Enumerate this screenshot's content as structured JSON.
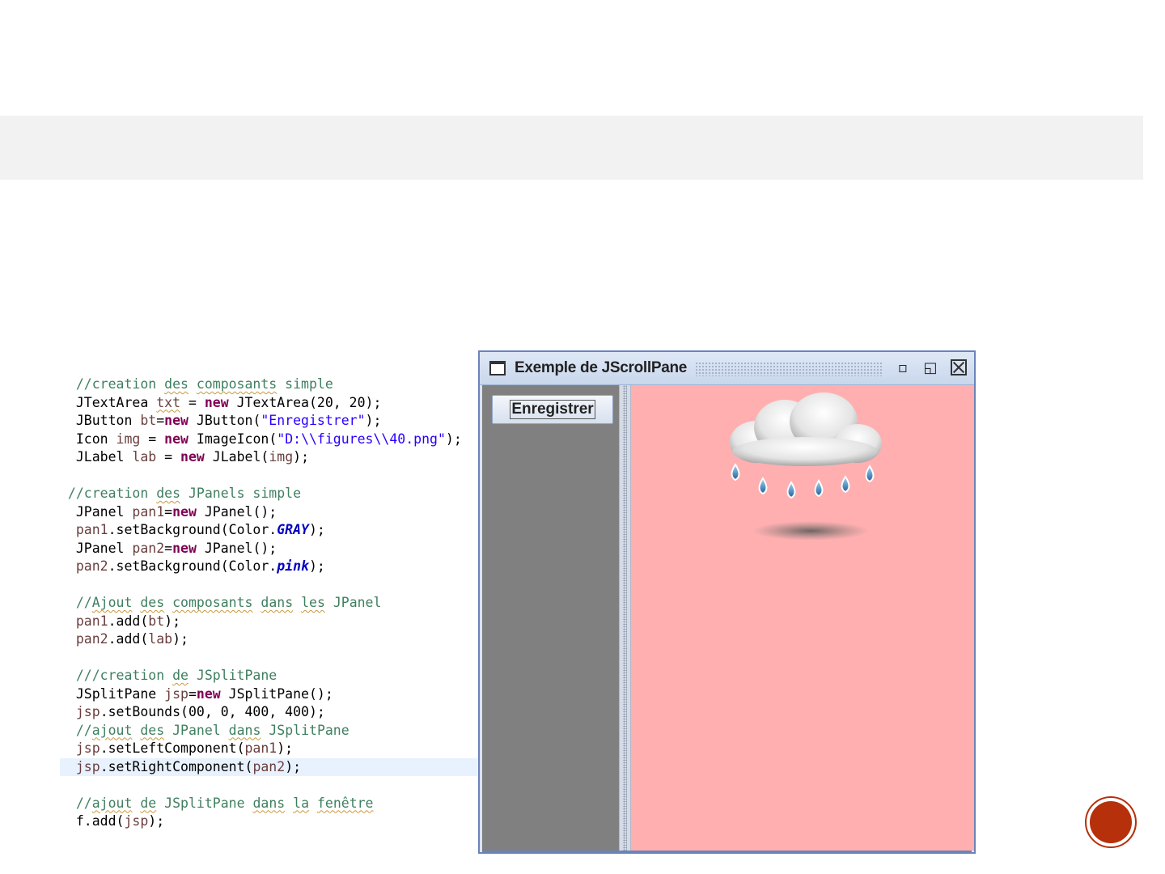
{
  "code_lines": [
    [
      {
        "t": "  //creation ",
        "c": "comment"
      },
      {
        "t": "des",
        "c": "comment",
        "sq": true
      },
      {
        "t": " ",
        "c": "comment"
      },
      {
        "t": "composants",
        "c": "comment",
        "sq": true
      },
      {
        "t": " simple",
        "c": "comment"
      }
    ],
    [
      {
        "t": "  JTextArea ",
        "c": "plain"
      },
      {
        "t": "txt",
        "c": "var",
        "sq": true
      },
      {
        "t": " = ",
        "c": "plain"
      },
      {
        "t": "new",
        "c": "kw"
      },
      {
        "t": " JTextArea(20, 20);",
        "c": "plain"
      }
    ],
    [
      {
        "t": "  JButton ",
        "c": "plain"
      },
      {
        "t": "bt",
        "c": "var"
      },
      {
        "t": "=",
        "c": "plain"
      },
      {
        "t": "new",
        "c": "kw"
      },
      {
        "t": " JButton(",
        "c": "plain"
      },
      {
        "t": "\"Enregistrer\"",
        "c": "str"
      },
      {
        "t": ");",
        "c": "plain"
      }
    ],
    [
      {
        "t": "  Icon ",
        "c": "plain"
      },
      {
        "t": "img",
        "c": "var"
      },
      {
        "t": " = ",
        "c": "plain"
      },
      {
        "t": "new",
        "c": "kw"
      },
      {
        "t": " ImageIcon(",
        "c": "plain"
      },
      {
        "t": "\"D:\\\\figures\\\\40.png\"",
        "c": "str"
      },
      {
        "t": ");",
        "c": "plain"
      }
    ],
    [
      {
        "t": "  JLabel ",
        "c": "plain"
      },
      {
        "t": "lab",
        "c": "var"
      },
      {
        "t": " = ",
        "c": "plain"
      },
      {
        "t": "new",
        "c": "kw"
      },
      {
        "t": " JLabel(",
        "c": "plain"
      },
      {
        "t": "img",
        "c": "var"
      },
      {
        "t": ");",
        "c": "plain"
      }
    ],
    [],
    [
      {
        "t": " //creation ",
        "c": "comment"
      },
      {
        "t": "des",
        "c": "comment",
        "sq": true
      },
      {
        "t": " JPanels simple",
        "c": "comment"
      }
    ],
    [
      {
        "t": "  JPanel ",
        "c": "plain"
      },
      {
        "t": "pan1",
        "c": "var"
      },
      {
        "t": "=",
        "c": "plain"
      },
      {
        "t": "new",
        "c": "kw"
      },
      {
        "t": " JPanel();",
        "c": "plain"
      }
    ],
    [
      {
        "t": "  ",
        "c": "plain"
      },
      {
        "t": "pan1",
        "c": "var"
      },
      {
        "t": ".setBackground(Color.",
        "c": "plain"
      },
      {
        "t": "GRAY",
        "c": "field"
      },
      {
        "t": ");",
        "c": "plain"
      }
    ],
    [
      {
        "t": "  JPanel ",
        "c": "plain"
      },
      {
        "t": "pan2",
        "c": "var"
      },
      {
        "t": "=",
        "c": "plain"
      },
      {
        "t": "new",
        "c": "kw"
      },
      {
        "t": " JPanel();",
        "c": "plain"
      }
    ],
    [
      {
        "t": "  ",
        "c": "plain"
      },
      {
        "t": "pan2",
        "c": "var"
      },
      {
        "t": ".setBackground(Color.",
        "c": "plain"
      },
      {
        "t": "pink",
        "c": "field"
      },
      {
        "t": ");",
        "c": "plain"
      }
    ],
    [],
    [
      {
        "t": "  //",
        "c": "comment"
      },
      {
        "t": "Ajout",
        "c": "comment",
        "sq": true
      },
      {
        "t": " ",
        "c": "comment"
      },
      {
        "t": "des",
        "c": "comment",
        "sq": true
      },
      {
        "t": " ",
        "c": "comment"
      },
      {
        "t": "composants",
        "c": "comment",
        "sq": true
      },
      {
        "t": " ",
        "c": "comment"
      },
      {
        "t": "dans",
        "c": "comment",
        "sq": true
      },
      {
        "t": " ",
        "c": "comment"
      },
      {
        "t": "les",
        "c": "comment",
        "sq": true
      },
      {
        "t": " JPanel",
        "c": "comment"
      }
    ],
    [
      {
        "t": "  ",
        "c": "plain"
      },
      {
        "t": "pan1",
        "c": "var"
      },
      {
        "t": ".add(",
        "c": "plain"
      },
      {
        "t": "bt",
        "c": "var"
      },
      {
        "t": ");",
        "c": "plain"
      }
    ],
    [
      {
        "t": "  ",
        "c": "plain"
      },
      {
        "t": "pan2",
        "c": "var"
      },
      {
        "t": ".add(",
        "c": "plain"
      },
      {
        "t": "lab",
        "c": "var"
      },
      {
        "t": ");",
        "c": "plain"
      }
    ],
    [],
    [
      {
        "t": "  ///creation ",
        "c": "comment"
      },
      {
        "t": "de",
        "c": "comment",
        "sq": true
      },
      {
        "t": " JSplitPane",
        "c": "comment"
      }
    ],
    [
      {
        "t": "  JSplitPane ",
        "c": "plain"
      },
      {
        "t": "jsp",
        "c": "var"
      },
      {
        "t": "=",
        "c": "plain"
      },
      {
        "t": "new",
        "c": "kw"
      },
      {
        "t": " JSplitPane();",
        "c": "plain"
      }
    ],
    [
      {
        "t": "  ",
        "c": "plain"
      },
      {
        "t": "jsp",
        "c": "var"
      },
      {
        "t": ".setBounds(00, 0, 400, 400);",
        "c": "plain"
      }
    ],
    [
      {
        "t": "  //",
        "c": "comment"
      },
      {
        "t": "ajout",
        "c": "comment",
        "sq": true
      },
      {
        "t": " ",
        "c": "comment"
      },
      {
        "t": "des",
        "c": "comment",
        "sq": true
      },
      {
        "t": " JPanel ",
        "c": "comment"
      },
      {
        "t": "dans",
        "c": "comment",
        "sq": true
      },
      {
        "t": " JSplitPane",
        "c": "comment"
      }
    ],
    [
      {
        "t": "  ",
        "c": "plain"
      },
      {
        "t": "jsp",
        "c": "var"
      },
      {
        "t": ".setLeftComponent(",
        "c": "plain"
      },
      {
        "t": "pan1",
        "c": "var"
      },
      {
        "t": ");",
        "c": "plain"
      }
    ],
    [
      {
        "t": "  ",
        "c": "plain"
      },
      {
        "t": "jsp",
        "c": "var"
      },
      {
        "t": ".setRightComponent(",
        "c": "plain"
      },
      {
        "t": "pan2",
        "c": "var"
      },
      {
        "t": ");",
        "c": "plain"
      }
    ],
    [],
    [
      {
        "t": "  //",
        "c": "comment"
      },
      {
        "t": "ajout",
        "c": "comment",
        "sq": true
      },
      {
        "t": " ",
        "c": "comment"
      },
      {
        "t": "de",
        "c": "comment",
        "sq": true
      },
      {
        "t": " JSplitPane ",
        "c": "comment"
      },
      {
        "t": "dans",
        "c": "comment",
        "sq": true
      },
      {
        "t": " ",
        "c": "comment"
      },
      {
        "t": "la",
        "c": "comment",
        "sq": true
      },
      {
        "t": " ",
        "c": "comment"
      },
      {
        "t": "fenêtre",
        "c": "comment",
        "sq": true
      }
    ],
    [
      {
        "t": "  f.add(",
        "c": "plain"
      },
      {
        "t": "jsp",
        "c": "var"
      },
      {
        "t": ");",
        "c": "plain"
      }
    ]
  ],
  "highlighted_line": 21,
  "window": {
    "title": "Exemple de JScrollPane",
    "button_label": "Enregistrer",
    "left_pane_color": "#808080",
    "right_pane_color": "#ffafaf",
    "image_icon": "rain-cloud-icon"
  },
  "colors": {
    "accent_badge": "#b5300b",
    "title_band": "#f2f2f2"
  }
}
